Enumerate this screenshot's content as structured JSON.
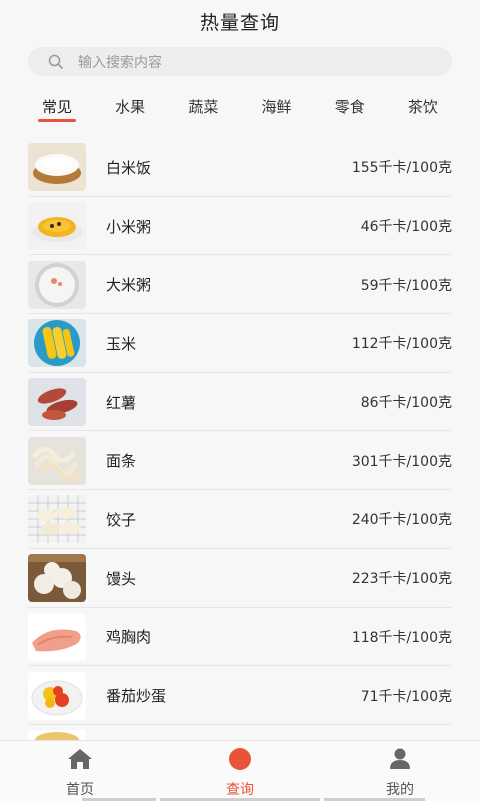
{
  "header": {
    "title": "热量查询"
  },
  "search": {
    "placeholder": "输入搜索内容"
  },
  "tabs": [
    {
      "label": "常见",
      "active": true
    },
    {
      "label": "水果"
    },
    {
      "label": "蔬菜"
    },
    {
      "label": "海鲜"
    },
    {
      "label": "零食"
    },
    {
      "label": "茶饮"
    }
  ],
  "foods": [
    {
      "name": "白米饭",
      "calories": "155千卡/100克",
      "image": "rice-bowl"
    },
    {
      "name": "小米粥",
      "calories": "46千卡/100克",
      "image": "millet-porridge"
    },
    {
      "name": "大米粥",
      "calories": "59千卡/100克",
      "image": "rice-porridge"
    },
    {
      "name": "玉米",
      "calories": "112千卡/100克",
      "image": "corn"
    },
    {
      "name": "红薯",
      "calories": "86千卡/100克",
      "image": "sweet-potato"
    },
    {
      "name": "面条",
      "calories": "301千卡/100克",
      "image": "noodles"
    },
    {
      "name": "饺子",
      "calories": "240千卡/100克",
      "image": "dumplings"
    },
    {
      "name": "馒头",
      "calories": "223千卡/100克",
      "image": "steamed-buns"
    },
    {
      "name": "鸡胸肉",
      "calories": "118千卡/100克",
      "image": "chicken-breast"
    },
    {
      "name": "番茄炒蛋",
      "calories": "71千卡/100克",
      "image": "tomato-egg"
    }
  ],
  "tabbar": [
    {
      "label": "首页",
      "icon": "home-icon"
    },
    {
      "label": "查询",
      "icon": "search-dot-icon",
      "active": true
    },
    {
      "label": "我的",
      "icon": "user-icon"
    }
  ],
  "colors": {
    "accent": "#e9533b",
    "background": "#f7f7f8"
  }
}
